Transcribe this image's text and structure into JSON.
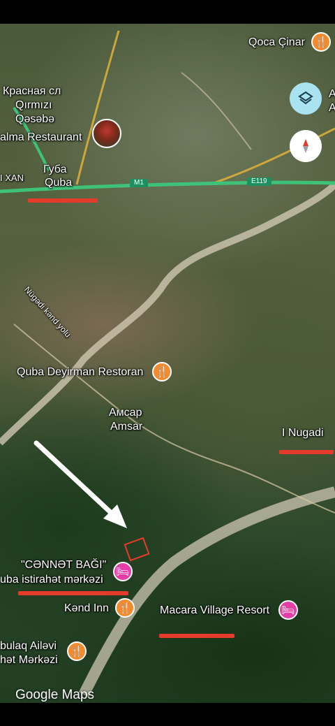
{
  "map": {
    "place_labels": [
      {
        "id": "krasnaya",
        "text": "Красная сл"
      },
      {
        "id": "qirmizi",
        "text": "Qırmızı"
      },
      {
        "id": "qesebe",
        "text": "Qəsəbə"
      },
      {
        "id": "alma",
        "text": "alma Restaurant"
      },
      {
        "id": "xan",
        "text": "I XAN"
      },
      {
        "id": "guba-ru",
        "text": "Губа"
      },
      {
        "id": "quba",
        "text": "Quba"
      },
      {
        "id": "nugedi-road",
        "text": "Nügədi kənd yolu"
      },
      {
        "id": "quba-deyirman",
        "text": "Quba Deyirman Restoran"
      },
      {
        "id": "amsar-ru",
        "text": "Амсар"
      },
      {
        "id": "amsar",
        "text": "Amsar"
      },
      {
        "id": "nugadi",
        "text": "I Nugadi"
      },
      {
        "id": "cennet",
        "text": "\"CƏNNƏT BAĞI\""
      },
      {
        "id": "cennet2",
        "text": "uba istirahət mərkəzi"
      },
      {
        "id": "kend-inn",
        "text": "Kənd Inn"
      },
      {
        "id": "macara",
        "text": "Macara Village Resort"
      },
      {
        "id": "bulaq",
        "text": "bulaq Ailəvi"
      },
      {
        "id": "bulaq2",
        "text": "hət Mərkəzi"
      },
      {
        "id": "qoca",
        "text": "Qoca Çinar"
      },
      {
        "id": "edge-a1",
        "text": "A"
      },
      {
        "id": "edge-a2",
        "text": "A"
      }
    ],
    "road_shields": [
      {
        "id": "m1",
        "text": "M1"
      },
      {
        "id": "e119",
        "text": "E119"
      }
    ],
    "attribution": "Google Maps",
    "icons": {
      "food": "fork-knife-icon",
      "hotel": "bed-icon",
      "layers": "layers-icon",
      "compass": "compass-icon",
      "arrow": "white-arrow-icon"
    },
    "colors": {
      "food_pin": "#f28b2e",
      "hotel_pin": "#e33ea6",
      "highway": "#3ec27a",
      "road": "#d8c9a8",
      "river": "#cfc7b2",
      "red_marker": "#e53b2a",
      "layers_button": "#a9e2f0"
    }
  }
}
